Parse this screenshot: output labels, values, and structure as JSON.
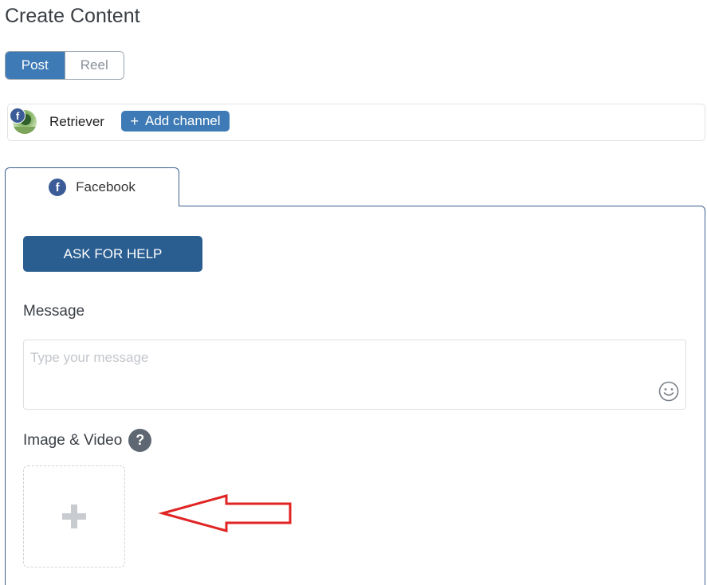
{
  "page": {
    "title": "Create Content"
  },
  "content_type_toggle": {
    "options": [
      {
        "label": "Post",
        "selected": true
      },
      {
        "label": "Reel",
        "selected": false
      }
    ]
  },
  "channels": {
    "selected": [
      {
        "name": "Retriever",
        "network_icon": "facebook-icon",
        "network_badge": "f"
      }
    ],
    "add_button_icon": "plus-icon",
    "add_button_plus": "+",
    "add_button_label": "Add channel"
  },
  "network_tabs": [
    {
      "label": "Facebook",
      "icon": "facebook-icon",
      "badge": "f",
      "active": true
    }
  ],
  "editor": {
    "ask_help_label": "ASK FOR HELP",
    "message_label": "Message",
    "message_value": "",
    "message_placeholder": "Type your message",
    "media_label": "Image & Video",
    "media_help_glyph": "?"
  },
  "colors": {
    "accent": "#3e7ab5",
    "primary_button": "#2a5d90",
    "facebook": "#3b5c97",
    "annotation": "#e02424"
  }
}
